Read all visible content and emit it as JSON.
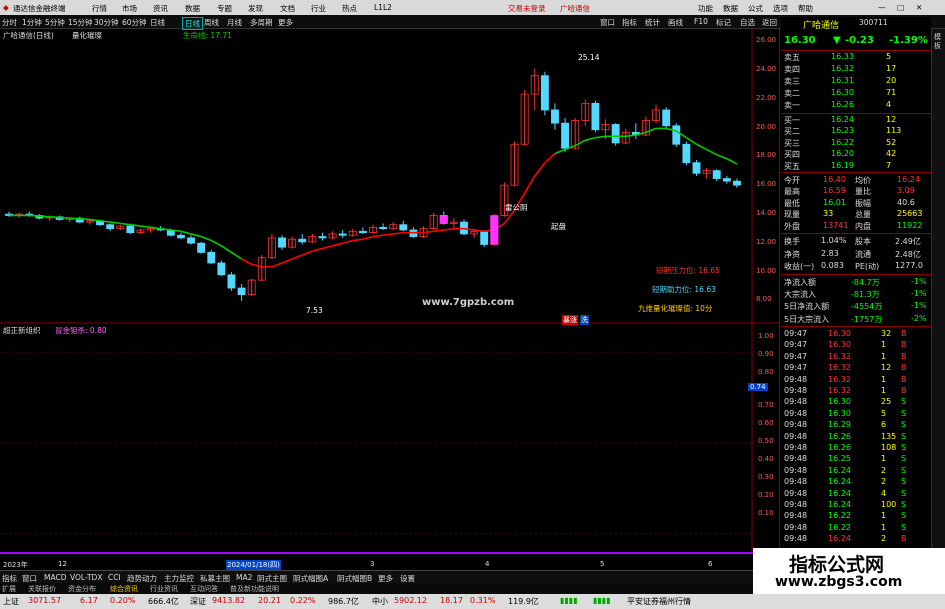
{
  "titlebar": {
    "app_name": "通达信金融终端",
    "menus": [
      "行情",
      "市场",
      "资讯",
      "数据",
      "专题",
      "发现",
      "文档",
      "行业",
      "热点",
      "L1L2"
    ],
    "center": [
      "交易未登录",
      "广哈通信"
    ],
    "right_menus": [
      "功能",
      "数据",
      "公式",
      "选项",
      "帮助"
    ]
  },
  "toolbar": {
    "periods": [
      "分时",
      "1分钟",
      "5分钟",
      "15分钟",
      "30分钟",
      "60分钟",
      "日线",
      "周线",
      "月线",
      "多周期",
      "更多"
    ],
    "active_period": "日线",
    "right_items": [
      "窗口",
      "指标",
      "统计",
      "画线",
      "F10",
      "标记",
      "自选",
      "返回"
    ]
  },
  "chart": {
    "header_left": "广哈通信(日线)",
    "header_indicator": "量化璀璨",
    "header_line_label": "生命线: 17.71",
    "high_label": "25.14",
    "low_label": "7.53",
    "annot_sunny": "雷公阴",
    "annot_up": "起盘",
    "website": "www.7gpzb.com",
    "label_short_pressure": "短期压力位: 16.65",
    "label_short_support": "短期助力位: 16.63",
    "label_nine": "九维量化璀璨值: 10分",
    "bottom_tags": [
      "暴涨",
      "洗"
    ],
    "price_ticks": [
      "26.00",
      "24.00",
      "22.00",
      "20.00",
      "18.00",
      "16.00",
      "14.00",
      "12.00",
      "10.00",
      "8.00"
    ],
    "sub_title": "超正新组织",
    "sub_indicator": "冒金狙杀: 0.80",
    "sub_ticks": [
      "1.00",
      "0.90",
      "0.80",
      "0.70",
      "0.60",
      "0.50",
      "0.40",
      "0.30",
      "0.20",
      "0.10"
    ],
    "sub_current": "0.74",
    "date_labels": [
      "2023年",
      "12",
      "2024/01/18(四)",
      "3",
      "4",
      "5",
      "6"
    ],
    "life_line_color": "#00cc00",
    "ma_color": "#ff0000",
    "up_color": "#ff3333",
    "down_color": "#54d8ff"
  },
  "chart_data": {
    "type": "candlestick",
    "title": "广哈通信(日线)",
    "ylim": [
      6,
      27
    ],
    "candles": [
      {
        "i": 0,
        "o": 14.1,
        "h": 14.3,
        "l": 13.9,
        "c": 14.0
      },
      {
        "i": 1,
        "o": 14.0,
        "h": 14.2,
        "l": 13.8,
        "c": 14.1
      },
      {
        "i": 2,
        "o": 14.1,
        "h": 14.3,
        "l": 13.9,
        "c": 14.0
      },
      {
        "i": 3,
        "o": 14.0,
        "h": 14.1,
        "l": 13.7,
        "c": 13.8
      },
      {
        "i": 4,
        "o": 13.8,
        "h": 14.0,
        "l": 13.6,
        "c": 13.9
      },
      {
        "i": 5,
        "o": 13.9,
        "h": 14.0,
        "l": 13.6,
        "c": 13.7
      },
      {
        "i": 6,
        "o": 13.7,
        "h": 13.9,
        "l": 13.5,
        "c": 13.8
      },
      {
        "i": 7,
        "o": 13.8,
        "h": 13.9,
        "l": 13.4,
        "c": 13.5
      },
      {
        "i": 8,
        "o": 13.5,
        "h": 13.7,
        "l": 13.3,
        "c": 13.6
      },
      {
        "i": 9,
        "o": 13.6,
        "h": 13.7,
        "l": 13.2,
        "c": 13.3
      },
      {
        "i": 10,
        "o": 13.3,
        "h": 13.4,
        "l": 12.8,
        "c": 13.0
      },
      {
        "i": 11,
        "o": 13.0,
        "h": 13.3,
        "l": 12.9,
        "c": 13.2
      },
      {
        "i": 12,
        "o": 13.2,
        "h": 13.3,
        "l": 12.6,
        "c": 12.7
      },
      {
        "i": 13,
        "o": 12.7,
        "h": 13.0,
        "l": 12.6,
        "c": 12.9
      },
      {
        "i": 14,
        "o": 12.9,
        "h": 13.1,
        "l": 12.7,
        "c": 13.0
      },
      {
        "i": 15,
        "o": 13.0,
        "h": 13.2,
        "l": 12.8,
        "c": 12.9
      },
      {
        "i": 16,
        "o": 12.9,
        "h": 13.0,
        "l": 12.4,
        "c": 12.5
      },
      {
        "i": 17,
        "o": 12.5,
        "h": 12.7,
        "l": 12.2,
        "c": 12.3
      },
      {
        "i": 18,
        "o": 12.3,
        "h": 12.5,
        "l": 11.8,
        "c": 11.9
      },
      {
        "i": 19,
        "o": 11.9,
        "h": 12.0,
        "l": 11.1,
        "c": 11.2
      },
      {
        "i": 20,
        "o": 11.2,
        "h": 11.4,
        "l": 10.3,
        "c": 10.4
      },
      {
        "i": 21,
        "o": 10.4,
        "h": 10.6,
        "l": 9.4,
        "c": 9.5
      },
      {
        "i": 22,
        "o": 9.5,
        "h": 9.7,
        "l": 8.3,
        "c": 8.5
      },
      {
        "i": 23,
        "o": 8.5,
        "h": 8.8,
        "l": 7.53,
        "c": 8.0
      },
      {
        "i": 24,
        "o": 8.0,
        "h": 9.2,
        "l": 7.9,
        "c": 9.1
      },
      {
        "i": 25,
        "o": 9.1,
        "h": 11.0,
        "l": 9.0,
        "c": 10.8
      },
      {
        "i": 26,
        "o": 10.8,
        "h": 12.6,
        "l": 10.7,
        "c": 12.3
      },
      {
        "i": 27,
        "o": 12.3,
        "h": 12.5,
        "l": 11.4,
        "c": 11.6
      },
      {
        "i": 28,
        "o": 11.6,
        "h": 12.4,
        "l": 11.5,
        "c": 12.2
      },
      {
        "i": 29,
        "o": 12.2,
        "h": 12.6,
        "l": 11.8,
        "c": 12.0
      },
      {
        "i": 30,
        "o": 12.0,
        "h": 12.6,
        "l": 11.9,
        "c": 12.4
      },
      {
        "i": 31,
        "o": 12.4,
        "h": 12.7,
        "l": 12.1,
        "c": 12.3
      },
      {
        "i": 32,
        "o": 12.3,
        "h": 12.8,
        "l": 12.2,
        "c": 12.6
      },
      {
        "i": 33,
        "o": 12.6,
        "h": 12.9,
        "l": 12.3,
        "c": 12.5
      },
      {
        "i": 34,
        "o": 12.5,
        "h": 13.0,
        "l": 12.4,
        "c": 12.8
      },
      {
        "i": 35,
        "o": 12.8,
        "h": 13.1,
        "l": 12.6,
        "c": 12.7
      },
      {
        "i": 36,
        "o": 12.7,
        "h": 13.3,
        "l": 12.6,
        "c": 13.1
      },
      {
        "i": 37,
        "o": 13.1,
        "h": 13.4,
        "l": 12.9,
        "c": 13.0
      },
      {
        "i": 38,
        "o": 13.0,
        "h": 13.5,
        "l": 12.9,
        "c": 13.3
      },
      {
        "i": 39,
        "o": 13.3,
        "h": 13.6,
        "l": 12.8,
        "c": 12.9
      },
      {
        "i": 40,
        "o": 12.9,
        "h": 13.1,
        "l": 12.3,
        "c": 12.4
      },
      {
        "i": 41,
        "o": 12.4,
        "h": 13.2,
        "l": 12.3,
        "c": 13.0
      },
      {
        "i": 42,
        "o": 13.0,
        "h": 14.2,
        "l": 12.9,
        "c": 14.0
      },
      {
        "i": 43,
        "o": 14.0,
        "h": 14.3,
        "l": 13.3,
        "c": 13.4
      },
      {
        "i": 44,
        "o": 13.4,
        "h": 13.8,
        "l": 13.0,
        "c": 13.5
      },
      {
        "i": 45,
        "o": 13.5,
        "h": 13.7,
        "l": 12.5,
        "c": 12.6
      },
      {
        "i": 46,
        "o": 12.6,
        "h": 13.0,
        "l": 12.3,
        "c": 12.8
      },
      {
        "i": 47,
        "o": 12.8,
        "h": 12.9,
        "l": 11.6,
        "c": 11.8
      },
      {
        "i": 48,
        "o": 11.8,
        "h": 14.1,
        "l": 11.7,
        "c": 14.0
      },
      {
        "i": 49,
        "o": 14.0,
        "h": 16.5,
        "l": 13.9,
        "c": 16.3
      },
      {
        "i": 50,
        "o": 16.3,
        "h": 19.6,
        "l": 16.2,
        "c": 19.4
      },
      {
        "i": 51,
        "o": 19.4,
        "h": 23.5,
        "l": 19.3,
        "c": 23.2
      },
      {
        "i": 52,
        "o": 23.2,
        "h": 25.14,
        "l": 22.0,
        "c": 24.6
      },
      {
        "i": 53,
        "o": 24.6,
        "h": 24.9,
        "l": 21.6,
        "c": 22.0
      },
      {
        "i": 54,
        "o": 22.0,
        "h": 22.5,
        "l": 20.5,
        "c": 21.0
      },
      {
        "i": 55,
        "o": 21.0,
        "h": 21.4,
        "l": 18.8,
        "c": 19.1
      },
      {
        "i": 56,
        "o": 19.1,
        "h": 21.4,
        "l": 19.0,
        "c": 21.2
      },
      {
        "i": 57,
        "o": 21.2,
        "h": 22.8,
        "l": 20.8,
        "c": 22.5
      },
      {
        "i": 58,
        "o": 22.5,
        "h": 22.7,
        "l": 20.3,
        "c": 20.5
      },
      {
        "i": 59,
        "o": 20.5,
        "h": 21.3,
        "l": 19.8,
        "c": 20.9
      },
      {
        "i": 60,
        "o": 20.9,
        "h": 21.0,
        "l": 19.3,
        "c": 19.5
      },
      {
        "i": 61,
        "o": 19.5,
        "h": 20.6,
        "l": 19.4,
        "c": 20.3
      },
      {
        "i": 62,
        "o": 20.3,
        "h": 21.0,
        "l": 19.8,
        "c": 20.1
      },
      {
        "i": 63,
        "o": 20.1,
        "h": 21.5,
        "l": 20.0,
        "c": 21.2
      },
      {
        "i": 64,
        "o": 21.2,
        "h": 22.4,
        "l": 21.0,
        "c": 22.0
      },
      {
        "i": 65,
        "o": 22.0,
        "h": 22.2,
        "l": 20.6,
        "c": 20.8
      },
      {
        "i": 66,
        "o": 20.8,
        "h": 21.0,
        "l": 19.2,
        "c": 19.4
      },
      {
        "i": 67,
        "o": 19.4,
        "h": 19.6,
        "l": 17.8,
        "c": 18.0
      },
      {
        "i": 68,
        "o": 18.0,
        "h": 18.2,
        "l": 17.0,
        "c": 17.2
      },
      {
        "i": 69,
        "o": 17.2,
        "h": 17.6,
        "l": 16.8,
        "c": 17.4
      },
      {
        "i": 70,
        "o": 17.4,
        "h": 17.5,
        "l": 16.6,
        "c": 16.8
      },
      {
        "i": 71,
        "o": 16.8,
        "h": 17.0,
        "l": 16.4,
        "c": 16.6
      },
      {
        "i": 72,
        "o": 16.6,
        "h": 16.8,
        "l": 16.1,
        "c": 16.3
      }
    ],
    "life_line": [
      14.0,
      14.0,
      14.0,
      13.95,
      13.9,
      13.85,
      13.8,
      13.75,
      13.7,
      13.6,
      13.5,
      13.4,
      13.3,
      13.2,
      13.1,
      13.0,
      12.9,
      12.8,
      12.6,
      12.4,
      12.1,
      11.7,
      11.2,
      10.7,
      10.3,
      10.1,
      10.1,
      10.4,
      10.7,
      11.0,
      11.3,
      11.5,
      11.7,
      11.9,
      12.1,
      12.2,
      12.4,
      12.5,
      12.6,
      12.7,
      12.7,
      12.7,
      12.8,
      12.9,
      13.0,
      13.0,
      12.9,
      12.8,
      12.9,
      13.4,
      14.4,
      15.7,
      17.0,
      18.0,
      18.7,
      19.0,
      19.3,
      19.7,
      19.9,
      20.0,
      20.0,
      20.0,
      20.1,
      20.3,
      20.6,
      20.6,
      20.4,
      19.9,
      19.4,
      19.0,
      18.6,
      18.3,
      17.9
    ],
    "sub_series": [],
    "sub_ylim": [
      0,
      1.05
    ]
  },
  "quote": {
    "price": "16.30",
    "name": "广哈通信",
    "code": "300711",
    "change": "-0.23",
    "pct": "-1.39%",
    "asks": [
      {
        "label": "卖五",
        "price": "16.33",
        "vol": "5"
      },
      {
        "label": "卖四",
        "price": "16.32",
        "vol": "17"
      },
      {
        "label": "卖三",
        "price": "16.31",
        "vol": "20"
      },
      {
        "label": "卖二",
        "price": "16.30",
        "vol": "71"
      },
      {
        "label": "卖一",
        "price": "16.26",
        "vol": "4"
      }
    ],
    "bids": [
      {
        "label": "买一",
        "price": "16.24",
        "vol": "12"
      },
      {
        "label": "买二",
        "price": "16.23",
        "vol": "113"
      },
      {
        "label": "买三",
        "price": "16.22",
        "vol": "52"
      },
      {
        "label": "买四",
        "price": "16.20",
        "vol": "42"
      },
      {
        "label": "买五",
        "price": "16.19",
        "vol": "7"
      }
    ],
    "stats": [
      {
        "l1": "今开",
        "v1": "16.40",
        "l2": "均价",
        "v2": "16.24"
      },
      {
        "l1": "最高",
        "v1": "16.59",
        "l2": "量比",
        "v2": "3.09"
      },
      {
        "l1": "最低",
        "v1": "16.01",
        "l2": "振幅",
        "v2": "40.6"
      },
      {
        "l1": "现量",
        "v1": "33",
        "l2": "总量",
        "v2": "25663"
      },
      {
        "l1": "外盘",
        "v1": "13741",
        "l2": "内盘",
        "v2": "11922"
      }
    ],
    "stats2": [
      {
        "l1": "换手",
        "v1": "1.04%",
        "l2": "股本",
        "v2": "2.49亿"
      },
      {
        "l1": "净资",
        "v1": "2.83",
        "l2": "流通",
        "v2": "2.48亿"
      },
      {
        "l1": "收益(一)",
        "v1": "0.083",
        "l2": "PE(动)",
        "v2": "1277.0"
      }
    ],
    "flows": [
      {
        "label": "净流入额",
        "value": "-84.7万",
        "pct": "-1%"
      },
      {
        "label": "大宗流入",
        "value": "-81.3万",
        "pct": "-1%"
      },
      {
        "label": "5日净流入额",
        "value": "-4554万",
        "pct": "-1%"
      },
      {
        "label": "5日大宗流入",
        "value": "-1757万",
        "pct": "-2%"
      }
    ],
    "ticks": [
      {
        "t": "09:47",
        "p": "16.30",
        "v": "32",
        "s": "B"
      },
      {
        "t": "09:47",
        "p": "16.30",
        "v": "1",
        "s": "B"
      },
      {
        "t": "09:47",
        "p": "16.32",
        "v": "1",
        "s": "B"
      },
      {
        "t": "09:47",
        "p": "16.32",
        "v": "12",
        "s": "B"
      },
      {
        "t": "09:48",
        "p": "16.32",
        "v": "1",
        "s": "B"
      },
      {
        "t": "09:48",
        "p": "16.32",
        "v": "1",
        "s": "B"
      },
      {
        "t": "09:48",
        "p": "16.30",
        "v": "25",
        "s": "S"
      },
      {
        "t": "09:48",
        "p": "16.30",
        "v": "5",
        "s": "S"
      },
      {
        "t": "09:48",
        "p": "16.29",
        "v": "6",
        "s": "S"
      },
      {
        "t": "09:48",
        "p": "16.26",
        "v": "135",
        "s": "S"
      },
      {
        "t": "09:48",
        "p": "16.26",
        "v": "108",
        "s": "S"
      },
      {
        "t": "09:48",
        "p": "16.25",
        "v": "1",
        "s": "S"
      },
      {
        "t": "09:48",
        "p": "16.24",
        "v": "2",
        "s": "S"
      },
      {
        "t": "09:48",
        "p": "16.24",
        "v": "2",
        "s": "S"
      },
      {
        "t": "09:48",
        "p": "16.24",
        "v": "4",
        "s": "S"
      },
      {
        "t": "09:48",
        "p": "16.24",
        "v": "100",
        "s": "S"
      },
      {
        "t": "09:48",
        "p": "16.22",
        "v": "1",
        "s": "S"
      },
      {
        "t": "09:48",
        "p": "16.22",
        "v": "1",
        "s": "S"
      },
      {
        "t": "09:48",
        "p": "16.24",
        "v": "2",
        "s": "B"
      }
    ]
  },
  "bottom_tabs": [
    "指标",
    "窗口",
    "MACD",
    "VOL-TDX",
    "CCI",
    "趋势动力",
    "主力监控",
    "私募主图",
    "MA2",
    "阴式主图",
    "阴式幅图A",
    "阴式幅图B",
    "更多",
    "设置"
  ],
  "bottom_tabs2": [
    "扩展",
    "关联报价",
    "资金分布",
    "综合资讯",
    "行业资讯",
    "互动问答",
    "普及新功能说明"
  ],
  "statusbar": {
    "items": [
      "上证",
      "3071.57",
      "6.17",
      "0.20%",
      "666.4亿",
      "深证",
      "9413.82",
      "20.21",
      "0.22%",
      "986.7亿",
      "中小",
      "5902.12",
      "18.17",
      "0.31%",
      "119.9亿",
      "平安证券福州行情"
    ]
  },
  "watermark": {
    "cn": "指标公式网",
    "url": "www.zbgs3.com"
  },
  "strip_tab": "模板"
}
